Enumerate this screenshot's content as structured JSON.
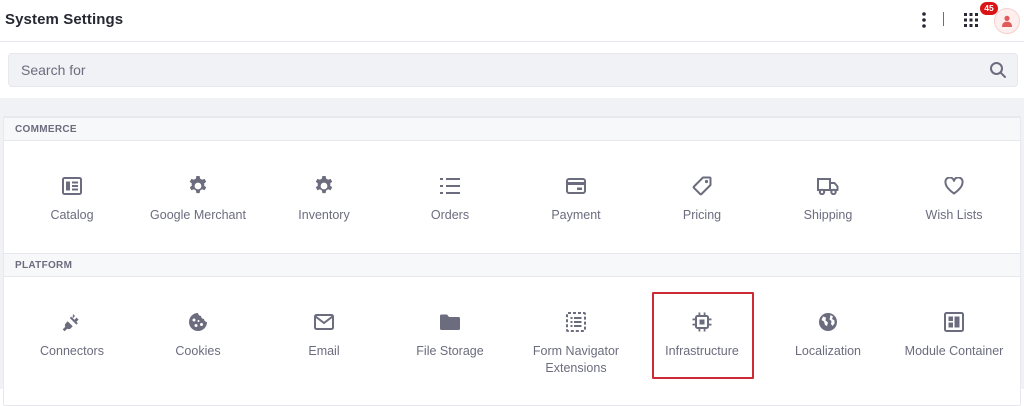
{
  "header": {
    "title": "System Settings",
    "notification_count": "45",
    "kebab_icon": "kebab-vertical-icon",
    "apps_icon": "grid-apps-icon",
    "avatar_icon": "user-icon"
  },
  "search": {
    "placeholder": "Search for",
    "value": "",
    "icon": "search-icon"
  },
  "sections": [
    {
      "title": "COMMERCE",
      "items": [
        {
          "label": "Catalog",
          "icon": "catalog-icon"
        },
        {
          "label": "Google Merchant",
          "icon": "gear-icon"
        },
        {
          "label": "Inventory",
          "icon": "gear-icon"
        },
        {
          "label": "Orders",
          "icon": "list-icon"
        },
        {
          "label": "Payment",
          "icon": "credit-card-icon"
        },
        {
          "label": "Pricing",
          "icon": "tag-icon"
        },
        {
          "label": "Shipping",
          "icon": "truck-icon"
        },
        {
          "label": "Wish Lists",
          "icon": "heart-icon"
        }
      ]
    },
    {
      "title": "PLATFORM",
      "items": [
        {
          "label": "Connectors",
          "icon": "plug-icon"
        },
        {
          "label": "Cookies",
          "icon": "cookie-icon"
        },
        {
          "label": "Email",
          "icon": "envelope-icon"
        },
        {
          "label": "File Storage",
          "icon": "folder-icon"
        },
        {
          "label": "Form Navigator Extensions",
          "icon": "form-icon"
        },
        {
          "label": "Infrastructure",
          "icon": "chip-icon",
          "highlighted": true
        },
        {
          "label": "Localization",
          "icon": "globe-icon"
        },
        {
          "label": "Module Container",
          "icon": "module-icon"
        }
      ]
    }
  ],
  "colors": {
    "highlight_border": "#cc2b36",
    "badge": "#da1414",
    "icon": "#6b6c7e"
  }
}
